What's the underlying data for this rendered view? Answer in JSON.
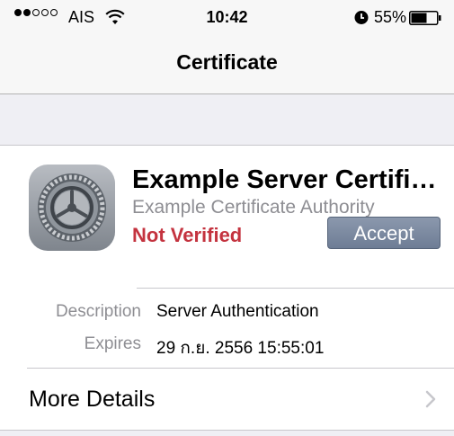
{
  "status_bar": {
    "carrier": "AIS",
    "signal_bars_filled": 2,
    "signal_bars_total": 5,
    "time": "10:42",
    "battery_percent": "55%",
    "icons": [
      "wifi-icon",
      "alarm-icon",
      "battery-icon"
    ]
  },
  "nav": {
    "title": "Certificate"
  },
  "certificate": {
    "icon": "settings-gear-icon",
    "name": "Example Server Certificate",
    "issuer": "Example Certificate Authority",
    "status": "Not Verified",
    "status_color": "#c4333f",
    "accept_label": "Accept"
  },
  "details": [
    {
      "key": "Description",
      "value": "Server Authentication"
    },
    {
      "key": "Expires",
      "value": "29 ก.ย. 2556 15:55:01"
    }
  ],
  "more": {
    "label": "More Details",
    "icon": "chevron-right-icon"
  }
}
